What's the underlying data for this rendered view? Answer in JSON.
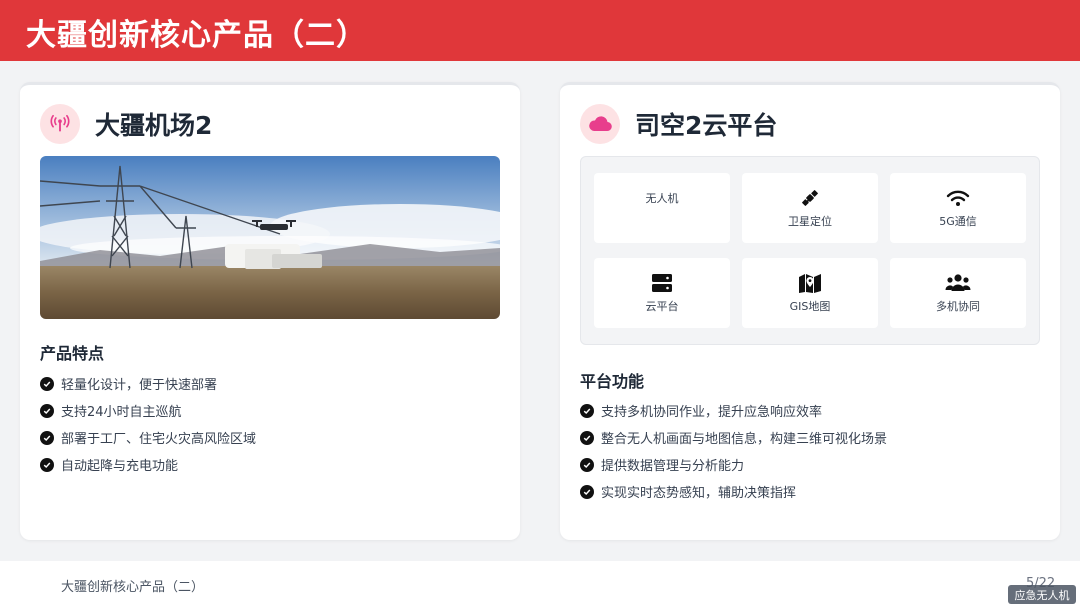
{
  "header": {
    "title": "大疆创新核心产品（二）"
  },
  "left_card": {
    "icon": "broadcast-tower-icon",
    "title": "大疆机场2",
    "photo": "drone-dock-power-line-photo",
    "features_title": "产品特点",
    "features": [
      "轻量化设计，便于快速部署",
      "支持24小时自主巡航",
      "部署于工厂、住宅火灾高风险区域",
      "自动起降与充电功能"
    ]
  },
  "right_card": {
    "icon": "cloud-icon",
    "title": "司空2云平台",
    "tiles": [
      {
        "label": "无人机",
        "icon": ""
      },
      {
        "label": "卫星定位",
        "icon": "satellite-icon"
      },
      {
        "label": "5G通信",
        "icon": "wifi-icon"
      },
      {
        "label": "云平台",
        "icon": "server-icon"
      },
      {
        "label": "GIS地图",
        "icon": "map-marker-icon"
      },
      {
        "label": "多机协同",
        "icon": "users-icon"
      }
    ],
    "functions_title": "平台功能",
    "functions": [
      "支持多机协同作业，提升应急响应效率",
      "整合无人机画面与地图信息，构建三维可视化场景",
      "提供数据管理与分析能力",
      "实现实时态势感知，辅助决策指挥"
    ]
  },
  "footer": {
    "text": "大疆创新核心产品（二）",
    "page": "5/22"
  },
  "watermark": "应急无人机",
  "colors": {
    "accent": "#e0373a",
    "icon_pink": "#e83e8c",
    "icon_bg": "#fde2e4"
  }
}
